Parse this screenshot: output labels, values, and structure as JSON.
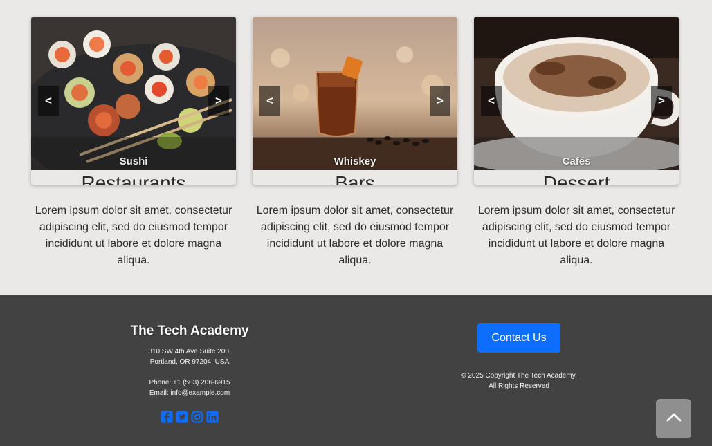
{
  "cards": [
    {
      "caption": "Sushi",
      "title": "Restaurants",
      "text": "Lorem ipsum dolor sit amet, consectetur adipiscing elit, sed do eiusmod tempor incididunt ut labore et dolore magna aliqua.",
      "prev": "<",
      "next": ">"
    },
    {
      "caption": "Whiskey",
      "title": "Bars",
      "text": "Lorem ipsum dolor sit amet, consectetur adipiscing elit, sed do eiusmod tempor incididunt ut labore et dolore magna aliqua.",
      "prev": "<",
      "next": ">"
    },
    {
      "caption": "Cafés",
      "title": "Dessert",
      "text": "Lorem ipsum dolor sit amet, consectetur adipiscing elit, sed do eiusmod tempor incididunt ut labore et dolore magna aliqua.",
      "prev": "<",
      "next": ">"
    }
  ],
  "footer": {
    "brand": "The Tech Academy",
    "address_line1": "310 SW 4th Ave Suite 200,",
    "address_line2": "Portland, OR 97204, USA",
    "phone": "Phone: +1 (503) 206-6915",
    "email": "Email: info@example.com",
    "socials": [
      "facebook-icon",
      "twitter-icon",
      "instagram-icon",
      "linkedin-icon"
    ],
    "contact_label": "Contact Us",
    "copyright_line1": "© 2025 Copyright The Tech Academy.",
    "copyright_line2": "All Rights Reserved"
  },
  "colors": {
    "page_bg": "#ebe9e7",
    "footer_bg": "#424242",
    "accent": "#0d6efd",
    "to_top_bg": "#8f8f8f"
  }
}
